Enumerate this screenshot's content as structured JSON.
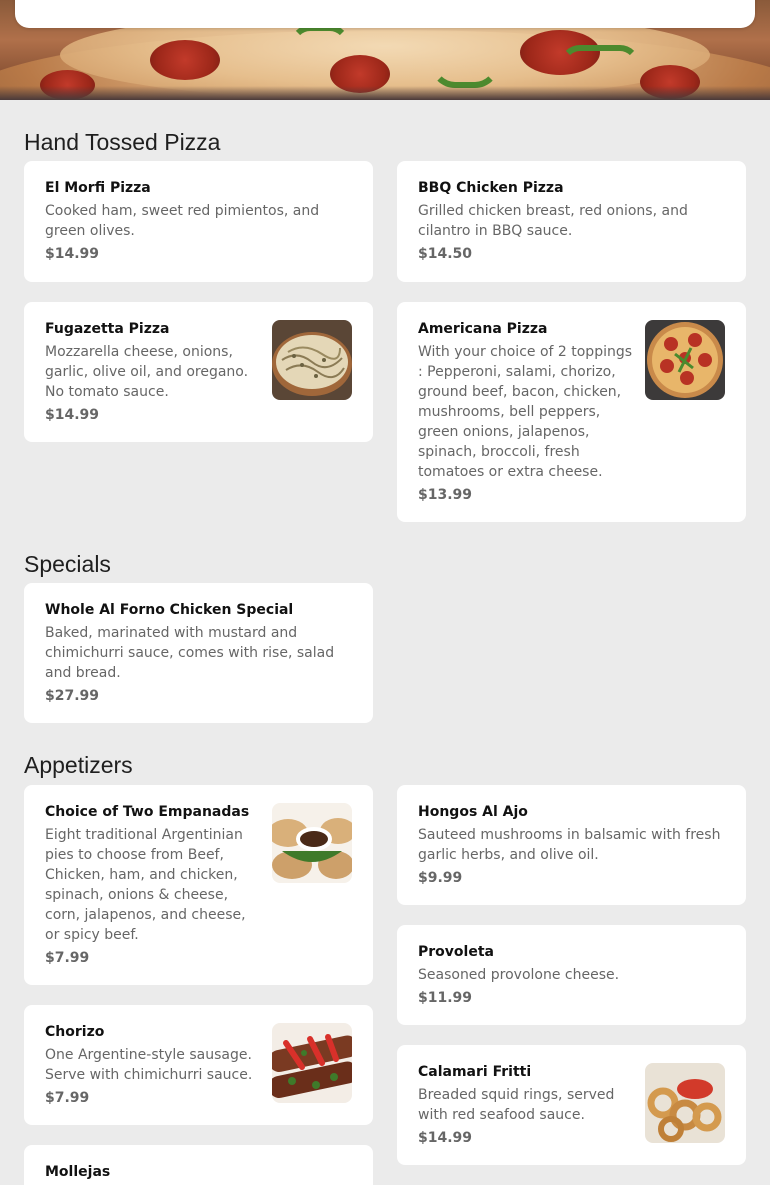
{
  "sections": [
    {
      "title": "Hand Tossed Pizza",
      "items": [
        {
          "name": "El Morfi Pizza",
          "desc": "Cooked ham, sweet red pimientos, and green olives.",
          "price": "$14.99"
        },
        {
          "name": "BBQ Chicken Pizza",
          "desc": "Grilled chicken breast, red onions, and cilantro in BBQ sauce.",
          "price": "$14.50"
        },
        {
          "name": "Fugazetta Pizza",
          "desc": "Mozzarella cheese, onions, garlic, olive oil, and oregano. No tomato sauce.",
          "price": "$14.99",
          "image": "fugazetta-pizza-photo"
        },
        {
          "name": "Americana Pizza",
          "desc": "With your choice of 2 toppings : Pepperoni, salami, chorizo, ground beef, bacon, chicken, mushrooms, bell peppers, green onions, jalapenos, spinach, broccoli, fresh tomatoes or extra cheese.",
          "price": "$13.99",
          "image": "pepperoni-pizza-photo"
        }
      ]
    },
    {
      "title": "Specials",
      "items": [
        {
          "name": "Whole Al Forno Chicken Special",
          "desc": "Baked, marinated with mustard and chimichurri sauce, comes with rise, salad and bread.",
          "price": "$27.99"
        }
      ]
    },
    {
      "title": "Appetizers",
      "items": [
        {
          "name": "Choice of Two Empanadas",
          "desc": "Eight traditional Argentinian pies to choose from Beef, Chicken, ham, and chicken, spinach, onions & cheese, corn, jalapenos, and cheese, or spicy beef.",
          "price": "$7.99",
          "image": "empanadas-photo"
        },
        {
          "name": "Hongos Al Ajo",
          "desc": "Sauteed mushrooms in balsamic with fresh garlic herbs, and olive oil.",
          "price": "$9.99"
        },
        {
          "name": "Provoleta",
          "desc": "Seasoned provolone cheese.",
          "price": "$11.99"
        },
        {
          "name": "Chorizo",
          "desc": "One Argentine-style sausage. Serve with chimichurri sauce.",
          "price": "$7.99",
          "image": "chorizo-photo"
        },
        {
          "name": "Calamari Fritti",
          "desc": "Breaded squid rings, served with red seafood sauce.",
          "price": "$14.99",
          "image": "calamari-photo"
        },
        {
          "name": "Mollejas",
          "desc": "",
          "price": ""
        }
      ]
    }
  ],
  "colors": {
    "background": "#ebebeb",
    "card": "#ffffff",
    "price": "#666666",
    "description": "#666666"
  }
}
